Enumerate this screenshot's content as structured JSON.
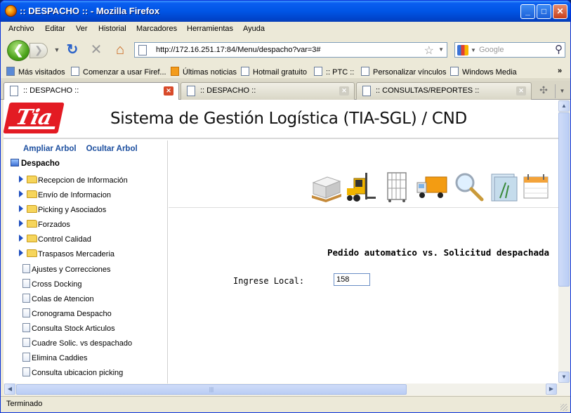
{
  "window": {
    "title": ":: DESPACHO :: - Mozilla Firefox"
  },
  "menu": [
    "Archivo",
    "Editar",
    "Ver",
    "Historial",
    "Marcadores",
    "Herramientas",
    "Ayuda"
  ],
  "nav": {
    "url": "http://172.16.251.17:84/Menu/despacho?var=3#",
    "search_placeholder": "Google"
  },
  "bookmarks": [
    "Más visitados",
    "Comenzar a usar Firef...",
    "Últimas noticias",
    "Hotmail gratuito",
    ":: PTC ::",
    "Personalizar vínculos",
    "Windows Media"
  ],
  "tabs": [
    {
      "label": ":: DESPACHO ::",
      "active": true
    },
    {
      "label": ":: DESPACHO ::",
      "active": false
    },
    {
      "label": ":: CONSULTAS/REPORTES ::",
      "active": false
    }
  ],
  "header": {
    "logo_text": "Tia",
    "title": "Sistema de Gestión Logística (TIA-SGL) / CND"
  },
  "tree": {
    "expand_label": "Ampliar Arbol",
    "hide_label": "Ocultar Arbol",
    "root": "Despacho",
    "folders": [
      "Recepcion de Información",
      "Envío de Informacion",
      "Picking y Asociados",
      "Forzados",
      "Control Calidad",
      "Traspasos Mercaderia"
    ],
    "items": [
      "Ajustes y Correcciones",
      "Cross Docking",
      "Colas de Atencion",
      "Cronograma Despacho",
      "Consulta Stock Articulos",
      "Cuadre Solic. vs despachado",
      "Elimina Caddies",
      "Consulta ubicacion picking"
    ]
  },
  "main": {
    "report_title": "Pedido automatico vs. Solicitud despachada",
    "local_label": "Ingrese Local:",
    "local_value": "158"
  },
  "status": "Terminado",
  "colors": {
    "titlebar": "#0055e5",
    "logo": "#e31b23",
    "link": "#1a4d9e"
  }
}
